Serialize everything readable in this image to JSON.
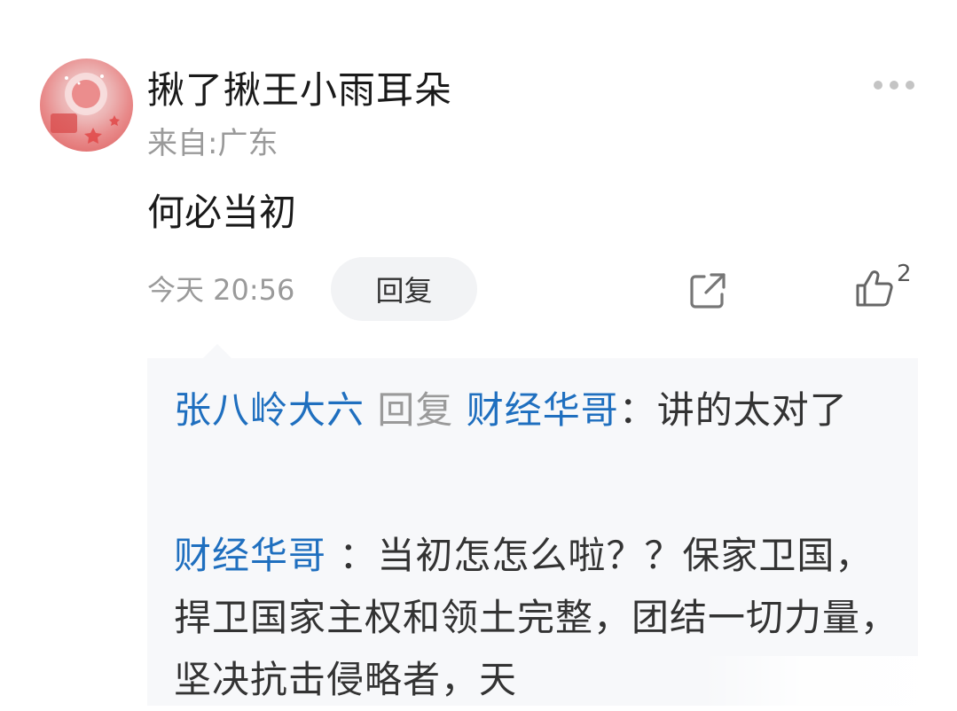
{
  "comment": {
    "username": "揪了揪王小雨耳朵",
    "location": "来自:广东",
    "text": "何必当初",
    "time": "今天 20:56",
    "reply_label": "回复",
    "like_count": "2"
  },
  "replies": [
    {
      "author": "张八岭大六",
      "reply_word": "回复",
      "target": "财经华哥",
      "separator": "：",
      "text": "讲的太对了"
    },
    {
      "author": "财经华哥",
      "separator": "：",
      "text": "当初怎怎么啦？？保家卫国，捍卫国家主权和领土完整，团结一切力量，坚决抗击侵略者，天"
    }
  ],
  "colors": {
    "username_link": "#1f6fbf",
    "reply_box_bg": "#f7f8fa",
    "secondary_text": "#9a9a9a"
  },
  "icons": [
    "more-icon",
    "share-icon",
    "like-icon"
  ]
}
